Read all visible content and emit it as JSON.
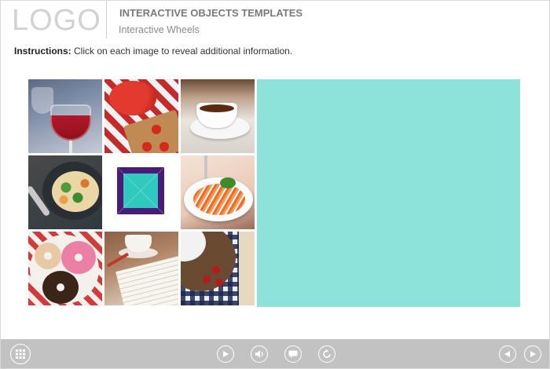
{
  "header": {
    "logo": "LOGO",
    "title": "INTERACTIVE OBJECTS TEMPLATES",
    "subtitle": "Interactive Wheels"
  },
  "instructions": {
    "label": "Instructions:",
    "text": "Click on each image to reveal additional information."
  },
  "grid": {
    "tiles": [
      {
        "icon": "wine-glass-image"
      },
      {
        "icon": "strawberries-image"
      },
      {
        "icon": "coffee-cup-image"
      },
      {
        "icon": "pasta-pan-image"
      },
      {
        "icon": "square-icon"
      },
      {
        "icon": "salad-bowl-image"
      },
      {
        "icon": "donuts-image"
      },
      {
        "icon": "book-coffee-image"
      },
      {
        "icon": "placemat-berries-image"
      }
    ]
  },
  "reveal_panel": {
    "color": "#8de3da"
  },
  "colors": {
    "accent_purple": "#4a1a78",
    "accent_teal": "#2fc9c0",
    "footer_bg": "#c2c2c2"
  },
  "footer": {
    "buttons": [
      {
        "name": "menu-grid-icon"
      },
      {
        "name": "play-icon"
      },
      {
        "name": "audio-icon"
      },
      {
        "name": "caption-icon"
      },
      {
        "name": "replay-icon"
      },
      {
        "name": "previous-icon"
      },
      {
        "name": "next-icon"
      }
    ]
  }
}
